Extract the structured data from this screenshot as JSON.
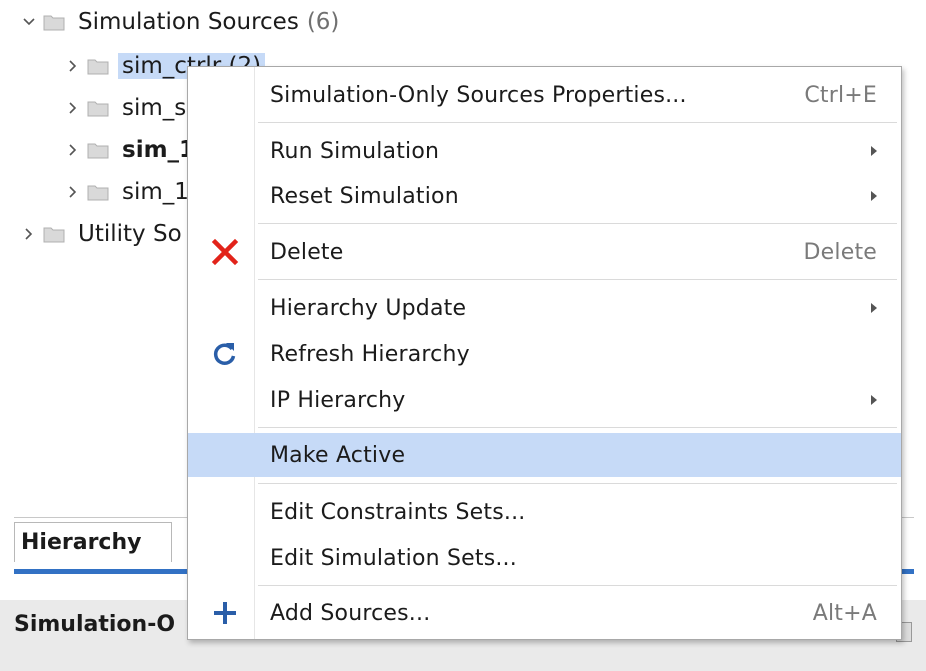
{
  "tree": {
    "simulation_sources": {
      "label": "Simulation Sources",
      "count": "(6)"
    },
    "children": [
      {
        "label": "sim_ctrlr (2)",
        "bold": false,
        "selected": true
      },
      {
        "label": "sim_s",
        "bold": false,
        "selected": false
      },
      {
        "label": "sim_1",
        "bold": true,
        "selected": false
      },
      {
        "label": "sim_1",
        "bold": false,
        "selected": false
      }
    ],
    "utility_sources": {
      "label": "Utility So"
    }
  },
  "panels": {
    "hierarchy_tab": "Hierarchy",
    "properties_title": "Simulation-O"
  },
  "menu": {
    "items": {
      "props": {
        "label": "Simulation-Only Sources Properties...",
        "shortcut": "Ctrl+E"
      },
      "run_sim": {
        "label": "Run Simulation",
        "submenu": true
      },
      "reset_sim": {
        "label": "Reset Simulation",
        "submenu": true
      },
      "delete": {
        "label": "Delete",
        "shortcut": "Delete",
        "icon": "delete-x-icon"
      },
      "hier_update": {
        "label": "Hierarchy Update",
        "submenu": true
      },
      "refresh": {
        "label": "Refresh Hierarchy",
        "icon": "refresh-icon"
      },
      "ip_hier": {
        "label": "IP Hierarchy",
        "submenu": true
      },
      "make_active": {
        "label": "Make Active",
        "highlighted": true
      },
      "edit_constraints": {
        "label": "Edit Constraints Sets..."
      },
      "edit_sim_sets": {
        "label": "Edit Simulation Sets..."
      },
      "add_sources": {
        "label": "Add Sources...",
        "shortcut": "Alt+A",
        "icon": "plus-icon"
      }
    }
  },
  "colors": {
    "selection": "#c6daf7",
    "delete_icon": "#e2231a",
    "icon_blue": "#2a5ea8",
    "tab_underline": "#3271c4"
  }
}
